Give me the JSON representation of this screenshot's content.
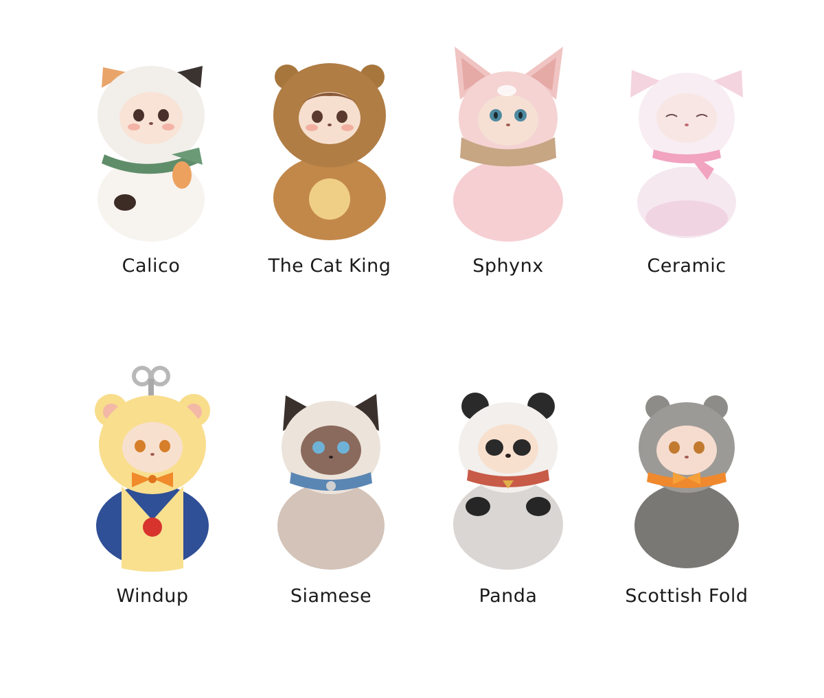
{
  "figures": [
    {
      "name": "Calico"
    },
    {
      "name": "The Cat King"
    },
    {
      "name": "Sphynx"
    },
    {
      "name": "Ceramic"
    },
    {
      "name": "Windup"
    },
    {
      "name": "Siamese"
    },
    {
      "name": "Panda"
    },
    {
      "name": "Scottish Fold"
    }
  ]
}
